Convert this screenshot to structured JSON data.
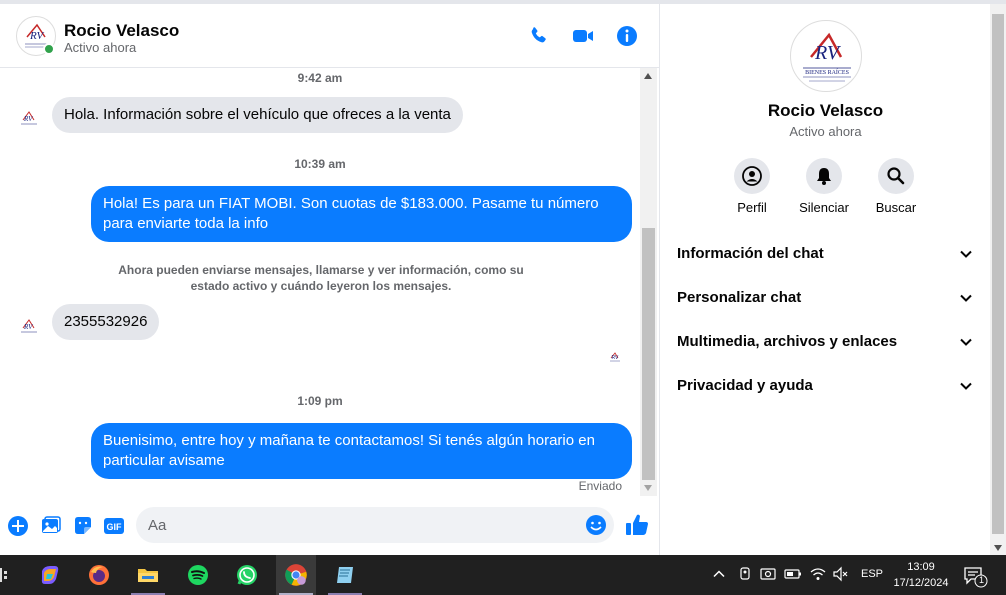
{
  "contact": {
    "name": "Rocio Velasco",
    "status": "Activo ahora",
    "avatar_brand": "RV",
    "avatar_subtitle": "BIENES RAÍCES"
  },
  "messages": {
    "time1": "9:42 am",
    "msg1": "Hola. Información sobre el vehículo que ofreces a la venta",
    "time2": "10:39 am",
    "msg2": "Hola! Es para un FIAT MOBI. Son cuotas de $183.000. Pasame tu número para enviarte toda la info",
    "system": "Ahora pueden enviarse mensajes, llamarse y ver información, como su estado activo y cuándo leyeron los mensajes.",
    "msg3": "2355532926",
    "time3": "1:09 pm",
    "msg4": "Buenisimo, entre hoy y mañana te contactamos! Si tenés algún horario en particular avisame",
    "sent_label": "Enviado"
  },
  "composer": {
    "placeholder": "Aa",
    "gif_label": "GIF"
  },
  "panel": {
    "actions": [
      {
        "label": "Perfil",
        "icon": "profile-icon"
      },
      {
        "label": "Silenciar",
        "icon": "bell-icon"
      },
      {
        "label": "Buscar",
        "icon": "search-icon"
      }
    ],
    "sections": [
      "Información del chat",
      "Personalizar chat",
      "Multimedia, archivos y enlaces",
      "Privacidad y ayuda"
    ]
  },
  "taskbar": {
    "apps": [
      "copilot-icon",
      "firefox-icon",
      "file-explorer-icon",
      "spotify-icon",
      "whatsapp-icon",
      "chrome-icon",
      "notepad-icon"
    ],
    "language": "ESP",
    "time": "13:09",
    "date": "17/12/2024",
    "notification_count": "1"
  },
  "colors": {
    "accent": "#0a7cff",
    "icon_blue": "#0a7cff",
    "incoming_bubble": "#e4e6eb",
    "online": "#31a24c"
  }
}
